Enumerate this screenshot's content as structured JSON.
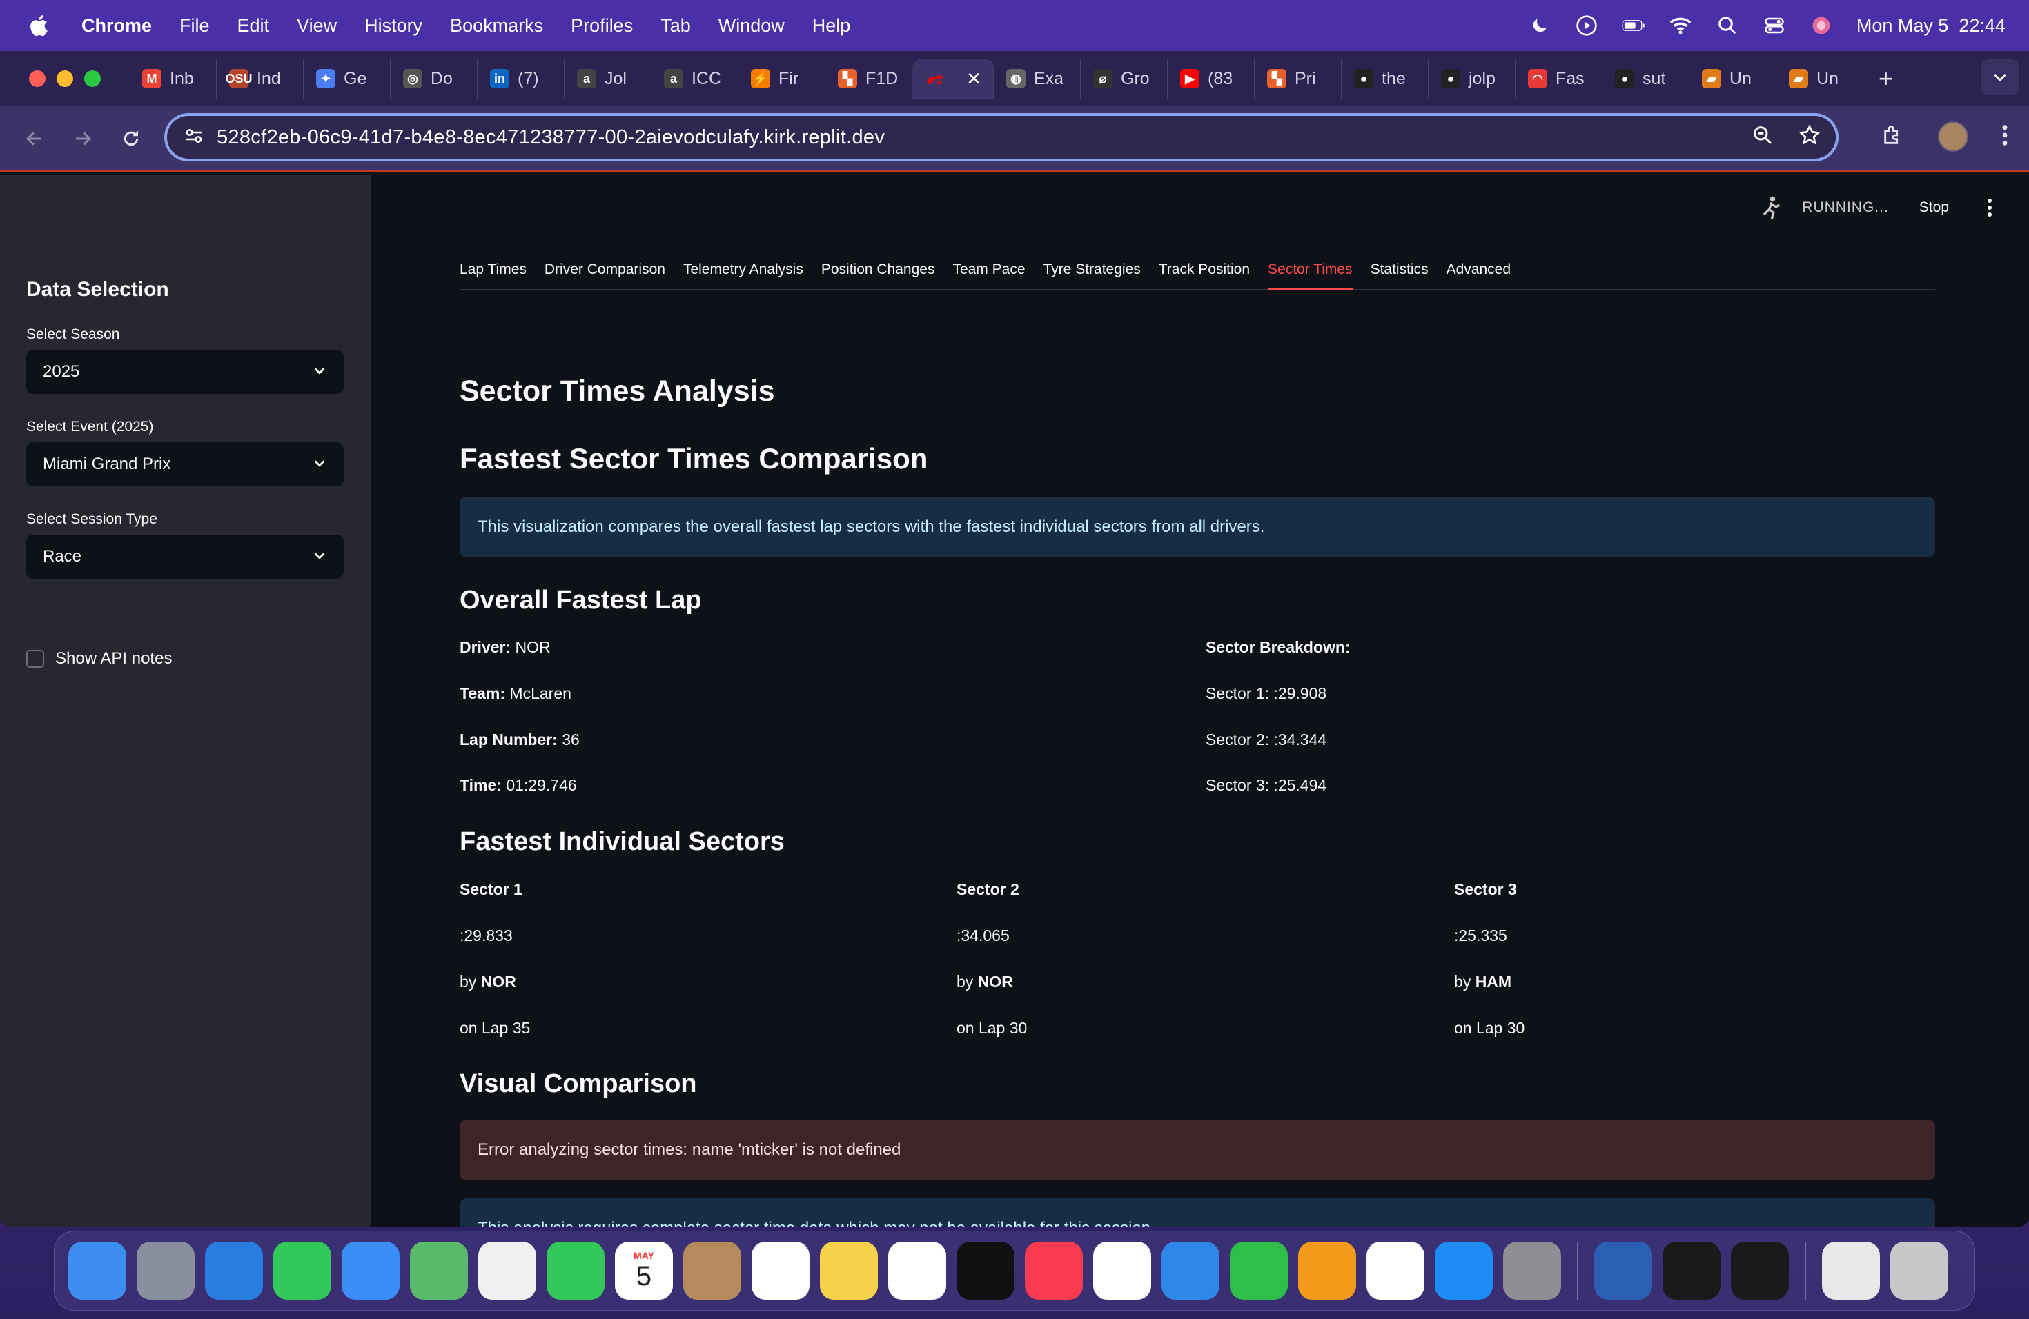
{
  "menubar": {
    "app": "Chrome",
    "items": [
      "File",
      "Edit",
      "View",
      "History",
      "Bookmarks",
      "Profiles",
      "Tab",
      "Window",
      "Help"
    ],
    "datetime": "Mon May 5  22:44"
  },
  "browser": {
    "tabs": [
      {
        "label": "Inb",
        "icon": "gmail-icon",
        "color": "#ea4335",
        "glyph": "M"
      },
      {
        "label": "Ind",
        "icon": "osu-icon",
        "color": "#b5452a",
        "glyph": "OSU"
      },
      {
        "label": "Ge",
        "icon": "gemini-icon",
        "color": "#4a7df0",
        "glyph": "✦"
      },
      {
        "label": "Do",
        "icon": "openai-icon",
        "color": "#555555",
        "glyph": "◎"
      },
      {
        "label": "(7)",
        "icon": "linkedin-icon",
        "color": "#0a66c2",
        "glyph": "in"
      },
      {
        "label": "Jol",
        "icon": "a-icon",
        "color": "#444444",
        "glyph": "a"
      },
      {
        "label": "ICC",
        "icon": "a-icon",
        "color": "#444444",
        "glyph": "a"
      },
      {
        "label": "Fir",
        "icon": "firebase-icon",
        "color": "#f57c00",
        "glyph": "⚡"
      },
      {
        "label": "F1D",
        "icon": "figma-icon",
        "color": "#e8612c",
        "glyph": "▚"
      }
    ],
    "active_tab": {
      "icon": "f1-car-icon",
      "close": "×"
    },
    "tabs_after": [
      {
        "label": "Exa",
        "icon": "globe-icon",
        "color": "#666666",
        "glyph": "◍"
      },
      {
        "label": "Gro",
        "icon": "grok-icon",
        "color": "#333333",
        "glyph": "⌀"
      },
      {
        "label": "(83",
        "icon": "youtube-icon",
        "color": "#ff0000",
        "glyph": "▶"
      },
      {
        "label": "Pri",
        "icon": "figma-icon",
        "color": "#e8612c",
        "glyph": "▚"
      },
      {
        "label": "the",
        "icon": "github-icon",
        "color": "#222222",
        "glyph": "●"
      },
      {
        "label": "jolp",
        "icon": "github-icon",
        "color": "#222222",
        "glyph": "●"
      },
      {
        "label": "Fas",
        "icon": "gauge-icon",
        "color": "#e53935",
        "glyph": "◠"
      },
      {
        "label": "sut",
        "icon": "github-icon",
        "color": "#222222",
        "glyph": "●"
      },
      {
        "label": "Un",
        "icon": "book-icon",
        "color": "#e07b1a",
        "glyph": "▰"
      },
      {
        "label": "Un",
        "icon": "book-icon",
        "color": "#e07b1a",
        "glyph": "▰"
      }
    ],
    "new_tab": "+",
    "url": "528cf2eb-06c9-41d7-b4e8-8ec471238777-00-2aievodculafy.kirk.replit.dev"
  },
  "sidebar": {
    "title": "Data Selection",
    "season_label": "Select Season",
    "season_value": "2025",
    "event_label": "Select Event (2025)",
    "event_value": "Miami Grand Prix",
    "session_label": "Select Session Type",
    "session_value": "Race",
    "api_notes_label": "Show API notes"
  },
  "status": {
    "running": "RUNNING...",
    "stop": "Stop"
  },
  "tabs": [
    "Lap Times",
    "Driver Comparison",
    "Telemetry Analysis",
    "Position Changes",
    "Team Pace",
    "Tyre Strategies",
    "Track Position",
    "Sector Times",
    "Statistics",
    "Advanced"
  ],
  "selected_tab": "Sector Times",
  "content": {
    "title": "Sector Times Analysis",
    "comparison_heading": "Fastest Sector Times Comparison",
    "info_text": "This visualization compares the overall fastest lap sectors with the fastest individual sectors from all drivers.",
    "fastest_lap_heading": "Overall Fastest Lap",
    "driver_label": "Driver:",
    "driver_value": " NOR",
    "team_label": "Team:",
    "team_value": " McLaren",
    "lap_label": "Lap Number:",
    "lap_value": " 36",
    "time_label": "Time:",
    "time_value": " 01:29.746",
    "breakdown_label": "Sector Breakdown:",
    "breakdown": [
      "Sector 1: :29.908",
      "Sector 2: :34.344",
      "Sector 3: :25.494"
    ],
    "individual_heading": "Fastest Individual Sectors",
    "sectors": [
      {
        "name": "Sector 1",
        "time": ":29.833",
        "by": "by ",
        "driver": "NOR",
        "lap": "on Lap 35"
      },
      {
        "name": "Sector 2",
        "time": ":34.065",
        "by": "by ",
        "driver": "NOR",
        "lap": "on Lap 30"
      },
      {
        "name": "Sector 3",
        "time": ":25.335",
        "by": "by ",
        "driver": "HAM",
        "lap": "on Lap 30"
      }
    ],
    "visual_heading": "Visual Comparison",
    "error_text": "Error analyzing sector times: name 'mticker' is not defined",
    "note_text": "This analysis requires complete sector time data which may not be available for this session."
  },
  "dock": [
    {
      "icon": "finder-icon",
      "color": "#3d8ef0"
    },
    {
      "icon": "launchpad-icon",
      "color": "#8a8fa0"
    },
    {
      "icon": "safari-icon",
      "color": "#2a7de0"
    },
    {
      "icon": "messages-icon",
      "color": "#34c759"
    },
    {
      "icon": "mail-icon",
      "color": "#3a8ef5"
    },
    {
      "icon": "maps-icon",
      "color": "#5ab96a"
    },
    {
      "icon": "photos-icon",
      "color": "#f0f0f0"
    },
    {
      "icon": "facetime-icon",
      "color": "#34c759"
    },
    {
      "icon": "calendar-icon",
      "color": "#ffffff"
    },
    {
      "icon": "contacts-icon",
      "color": "#b58a5c"
    },
    {
      "icon": "reminders-icon",
      "color": "#ffffff"
    },
    {
      "icon": "notes-icon",
      "color": "#f7d14a"
    },
    {
      "icon": "freeform-icon",
      "color": "#ffffff"
    },
    {
      "icon": "appletv-icon",
      "color": "#111111"
    },
    {
      "icon": "music-icon",
      "color": "#fa3a4f"
    },
    {
      "icon": "news-icon",
      "color": "#ffffff"
    },
    {
      "icon": "keynote-icon",
      "color": "#2f87e8"
    },
    {
      "icon": "numbers-icon",
      "color": "#2fbe4a"
    },
    {
      "icon": "pages-icon",
      "color": "#f39a1a"
    },
    {
      "icon": "chrome-icon",
      "color": "#ffffff"
    },
    {
      "icon": "appstore-icon",
      "color": "#1d8cf5"
    },
    {
      "icon": "settings-icon",
      "color": "#8e8e93"
    }
  ],
  "dock_right": [
    {
      "icon": "word-icon",
      "color": "#2b5fb4"
    },
    {
      "icon": "activity-monitor-icon",
      "color": "#1a1a1a"
    },
    {
      "icon": "terminal-icon",
      "color": "#1a1a1a"
    }
  ],
  "dock_end": [
    {
      "icon": "document-icon",
      "color": "#e8e8e8"
    },
    {
      "icon": "trash-icon",
      "color": "#c8c8c8"
    }
  ],
  "calendar": {
    "month": "MAY",
    "day": "5"
  }
}
